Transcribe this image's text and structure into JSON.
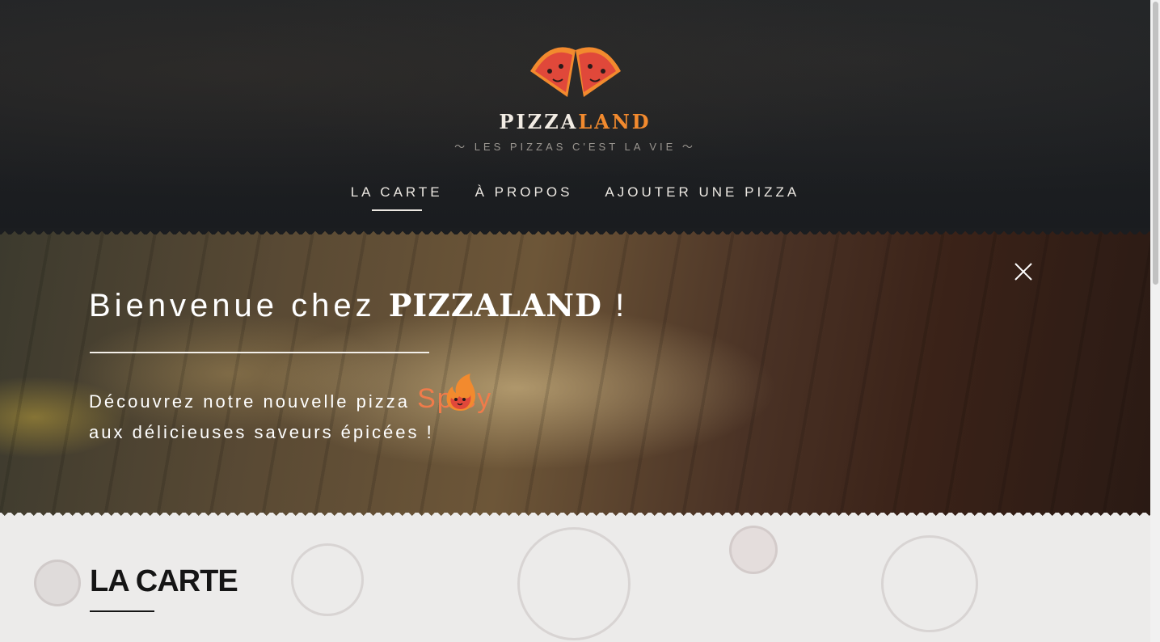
{
  "header": {
    "brand_part1": "PIZZA",
    "brand_part2": "LAND",
    "tagline": "〜 LES PIZZAS C'EST LA VIE 〜",
    "nav": [
      {
        "label": "LA CARTE",
        "active": true
      },
      {
        "label": "À PROPOS",
        "active": false
      },
      {
        "label": "AJOUTER UNE PIZZA",
        "active": false
      }
    ]
  },
  "hero": {
    "welcome_prefix": "Bienvenue chez",
    "welcome_brand_part1": "PIZZA",
    "welcome_brand_part2": "LAND",
    "welcome_suffix": "!",
    "promo_line1": "Découvrez notre nouvelle pizza",
    "promo_highlight": "Spicy",
    "promo_line2": "aux délicieuses saveurs épicées !",
    "close_icon": "close-icon",
    "flame_icon": "flame-emoji-icon"
  },
  "menu": {
    "title": "LA CARTE"
  },
  "colors": {
    "accent": "#f28a2e",
    "spicy": "#f07b4a",
    "header_bg": "#1c1f22",
    "section_bg": "#ecebea"
  }
}
